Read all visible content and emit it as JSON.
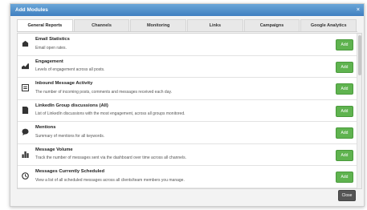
{
  "dialog": {
    "title": "Add Modules",
    "close_x": "×",
    "close_button": "Close"
  },
  "tabs": [
    {
      "label": "General Reports"
    },
    {
      "label": "Channels"
    },
    {
      "label": "Monitoring"
    },
    {
      "label": "Links"
    },
    {
      "label": "Campaigns"
    },
    {
      "label": "Google Analytics"
    }
  ],
  "modules": [
    {
      "title": "Email Statistics",
      "desc": "Email open rates.",
      "button": "Add",
      "icon": "email-icon"
    },
    {
      "title": "Engagement",
      "desc": "Levels of engagement across all posts.",
      "button": "Add",
      "icon": "engagement-chart-icon"
    },
    {
      "title": "Inbound Message Activity",
      "desc": "The number of incoming posts, comments and messages received each day.",
      "button": "Add",
      "icon": "inbound-message-icon"
    },
    {
      "title": "LinkedIn Group discussions (All)",
      "desc": "List of LinkedIn discussions with the most engagement, across all groups monitored.",
      "button": "Add",
      "icon": "document-icon"
    },
    {
      "title": "Mentions",
      "desc": "Summary of mentions for all keywords.",
      "button": "Add",
      "icon": "speech-bubble-icon"
    },
    {
      "title": "Message Volume",
      "desc": "Track the number of messages sent via the dashboard over time across all channels.",
      "button": "Add",
      "icon": "bar-chart-icon"
    },
    {
      "title": "Messages Currently Scheduled",
      "desc": "View a list of all scheduled messages across all clients/team members you manage.",
      "button": "Add",
      "icon": "clock-icon"
    }
  ]
}
